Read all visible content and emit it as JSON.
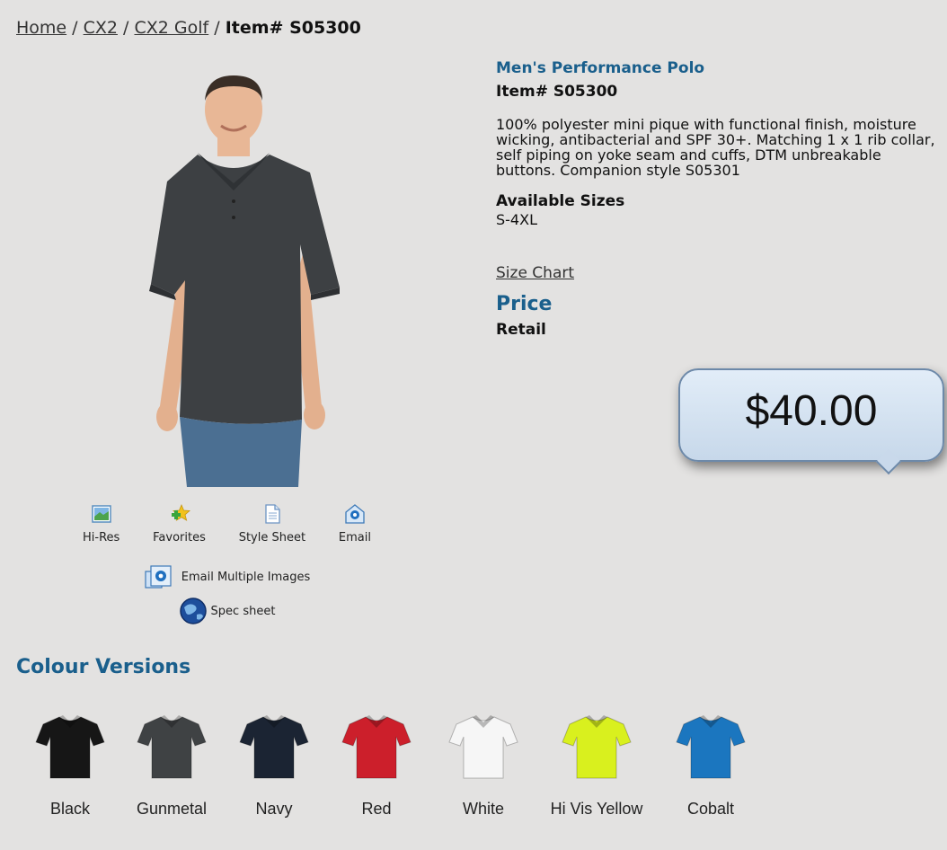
{
  "breadcrumb": {
    "home": "Home",
    "sep": "/",
    "cat1": "CX2",
    "cat2": "CX2 Golf",
    "current": "Item# S05300"
  },
  "tools": {
    "hi_res": "Hi-Res",
    "favorites": "Favorites",
    "style_sheet": "Style Sheet",
    "email": "Email",
    "email_multi": "Email Multiple Images",
    "spec_sheet": "Spec sheet",
    "icons": [
      "image-icon",
      "star-plus-icon",
      "document-icon",
      "email-icon",
      "email-multiple-icon",
      "globe-icon"
    ]
  },
  "product": {
    "name": "Men's Performance Polo",
    "item": "Item# S05300",
    "description": "100% polyester mini pique with functional finish, moisture wicking, antibacterial and SPF 30+. Matching 1 x 1 rib collar, self piping on yoke seam and cuffs, DTM unbreakable buttons. Companion style S05301",
    "sizes_heading": "Available Sizes",
    "sizes": "S-4XL",
    "size_chart": "Size Chart",
    "price_heading": "Price",
    "retail_label": "Retail",
    "price": "$40.00"
  },
  "colours": {
    "heading": "Colour Versions",
    "items": [
      {
        "label": "Black",
        "color": "#161616"
      },
      {
        "label": "Gunmetal",
        "color": "#3f4244"
      },
      {
        "label": "Navy",
        "color": "#1b2433"
      },
      {
        "label": "Red",
        "color": "#cc1f2b"
      },
      {
        "label": "White",
        "color": "#f6f6f6"
      },
      {
        "label": "Hi Vis Yellow",
        "color": "#d9f01e"
      },
      {
        "label": "Cobalt",
        "color": "#1b76bf"
      }
    ]
  },
  "colors": {
    "link_blue": "#1a5f8c",
    "background": "#e3e2e1",
    "shirt": "#3d4043",
    "jeans": "#4b6f92"
  }
}
